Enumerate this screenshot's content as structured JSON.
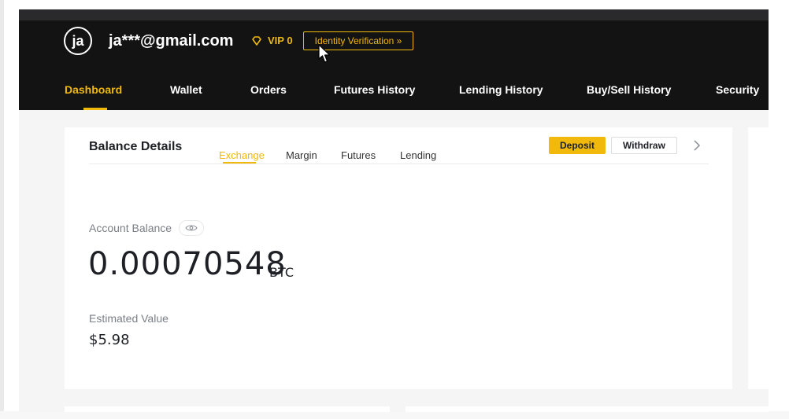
{
  "user": {
    "avatar_initials": "ja",
    "email": "ja***@gmail.com",
    "vip_label": "VIP 0",
    "verification_label": "Identity Verification »"
  },
  "nav": {
    "items": [
      {
        "label": "Dashboard",
        "active": true
      },
      {
        "label": "Wallet"
      },
      {
        "label": "Orders"
      },
      {
        "label": "Futures History"
      },
      {
        "label": "Lending History"
      },
      {
        "label": "Buy/Sell History"
      },
      {
        "label": "Security"
      }
    ]
  },
  "balance": {
    "title": "Balance Details",
    "tabs": [
      {
        "label": "Exchange",
        "active": true
      },
      {
        "label": "Margin"
      },
      {
        "label": "Futures"
      },
      {
        "label": "Lending"
      }
    ],
    "deposit_label": "Deposit",
    "withdraw_label": "Withdraw",
    "account_balance_label": "Account Balance",
    "amount": "0.00070548",
    "unit": "BTC",
    "estimated_label": "Estimated Value",
    "estimated_value": "$5.98"
  },
  "icons": {
    "vip": "diamond-icon",
    "eye": "eye-icon",
    "chevron": "chevron-right-icon",
    "cursor": "mouse-cursor-icon"
  },
  "colors": {
    "accent": "#f0b90b",
    "header_bg": "#131313",
    "page_bg": "#f5f5f5"
  }
}
